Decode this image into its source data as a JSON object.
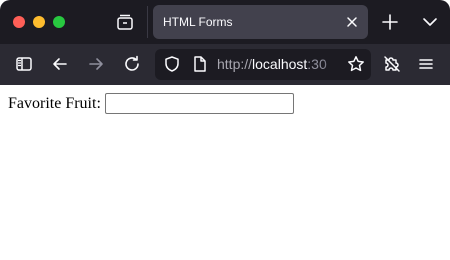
{
  "browser": {
    "tab": {
      "title": "HTML Forms"
    },
    "url": {
      "scheme": "http://",
      "host": "localhost",
      "port": ":30"
    },
    "icons": {
      "window_controls": [
        "close-button",
        "minimize-button",
        "maximize-button"
      ],
      "tab_strip": [
        "tab-overview-icon",
        "close-icon",
        "plus-icon",
        "chevron-down-icon"
      ],
      "toolbar": [
        "sidebar-icon",
        "back-arrow-icon",
        "forward-arrow-icon",
        "reload-icon",
        "shield-icon",
        "page-icon",
        "star-icon",
        "extensions-icon",
        "menu-icon"
      ]
    },
    "colors": {
      "tabstrip_bg": "#1c1b22",
      "toolbar_bg": "#2b2a33",
      "active_tab_bg": "#42414d",
      "traffic_close": "#ff5f57",
      "traffic_min": "#febc2e",
      "traffic_max": "#28c840"
    }
  },
  "page": {
    "form": {
      "fruit_label": "Favorite Fruit:",
      "fruit_value": ""
    }
  }
}
